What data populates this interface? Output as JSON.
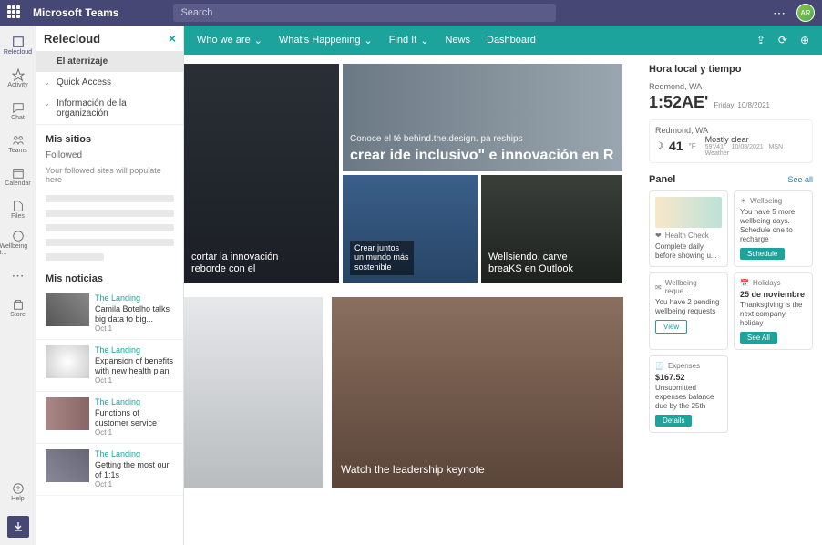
{
  "topbar": {
    "app_name": "Microsoft Teams",
    "search_placeholder": "Search",
    "avatar_initials": "AR"
  },
  "rail": [
    {
      "label": "Relecloud"
    },
    {
      "label": "Activity"
    },
    {
      "label": "Chat"
    },
    {
      "label": "Teams"
    },
    {
      "label": "Calendar"
    },
    {
      "label": "Files"
    },
    {
      "label": "Wellbeing t..."
    },
    {
      "label": "..."
    },
    {
      "label": "Store"
    }
  ],
  "rail_help": "Help",
  "sidepanel": {
    "title": "Relecloud",
    "nav": [
      {
        "label": "El aterrizaje",
        "expandable": false
      },
      {
        "label": "Quick Access",
        "expandable": true
      },
      {
        "label": "Información de la organización",
        "expandable": true
      }
    ],
    "sites_title": "Mis sitios",
    "followed_label": "Followed",
    "followed_empty": "Your followed sites will populate here",
    "news_title": "Mis noticias",
    "news": [
      {
        "source": "The Landing",
        "title": "Camila Botelho talks big data to big...",
        "date": "Oct 1"
      },
      {
        "source": "The Landing",
        "title": "Expansion of benefits with new health plan",
        "date": "Oct 1"
      },
      {
        "source": "The Landing",
        "title": "Functions of customer service",
        "date": "Oct 1"
      },
      {
        "source": "The Landing",
        "title": "Getting the most our of 1:1s",
        "date": "Oct 1"
      }
    ]
  },
  "navbar": {
    "items": [
      "Who we are",
      "What's Happening",
      "Find It",
      "News",
      "Dashboard"
    ]
  },
  "hero": {
    "tile_a": {
      "line1": "cortar la innovación",
      "line2": "reborde con el"
    },
    "tile_b": {
      "sub": "Conoce el té behind.the.design. pa reships",
      "title": "crear ide inclusivo\" e innovación en R"
    },
    "tile_c": {
      "line1": "Crear juntos",
      "line2": "un mundo más",
      "line3": "sostenible"
    },
    "tile_d": {
      "line1": "Wellsiendo. carve",
      "line2": "breaKS en Outlook"
    },
    "sec_b_caption": "Watch the leadership keynote"
  },
  "right": {
    "time_title": "Hora local y tiempo",
    "location": "Redmond, WA",
    "time": "1:52AE'",
    "date": "Friday, 10/8/2021",
    "weather": {
      "location": "Redmond, WA",
      "temp": "41",
      "unit": "°F",
      "hilo": "59°/41°",
      "desc": "Mostly clear",
      "date": "10/08/2021",
      "provider": "MSN Weather"
    },
    "panel_title": "Panel",
    "see_all": "See all",
    "cards": {
      "health": {
        "label": "Health Check",
        "body": "Complete daily before showing u..."
      },
      "wellbeing_days": {
        "label": "Wellbeing",
        "body": "You have 5 more wellbeing days. Schedule one to recharge",
        "btn": "Schedule"
      },
      "wellbeing_req": {
        "label": "Wellbeing reque...",
        "body": "You have 2 pending wellbeing requests",
        "btn": "View"
      },
      "holidays": {
        "label": "Holidays",
        "title": "25 de noviembre",
        "body": "Thanksgiving is the next company holiday",
        "btn": "See All"
      },
      "expenses": {
        "label": "Expenses",
        "title": "$167.52",
        "body": "Unsubmitted expenses balance due by the 25th",
        "btn": "Details"
      }
    }
  }
}
